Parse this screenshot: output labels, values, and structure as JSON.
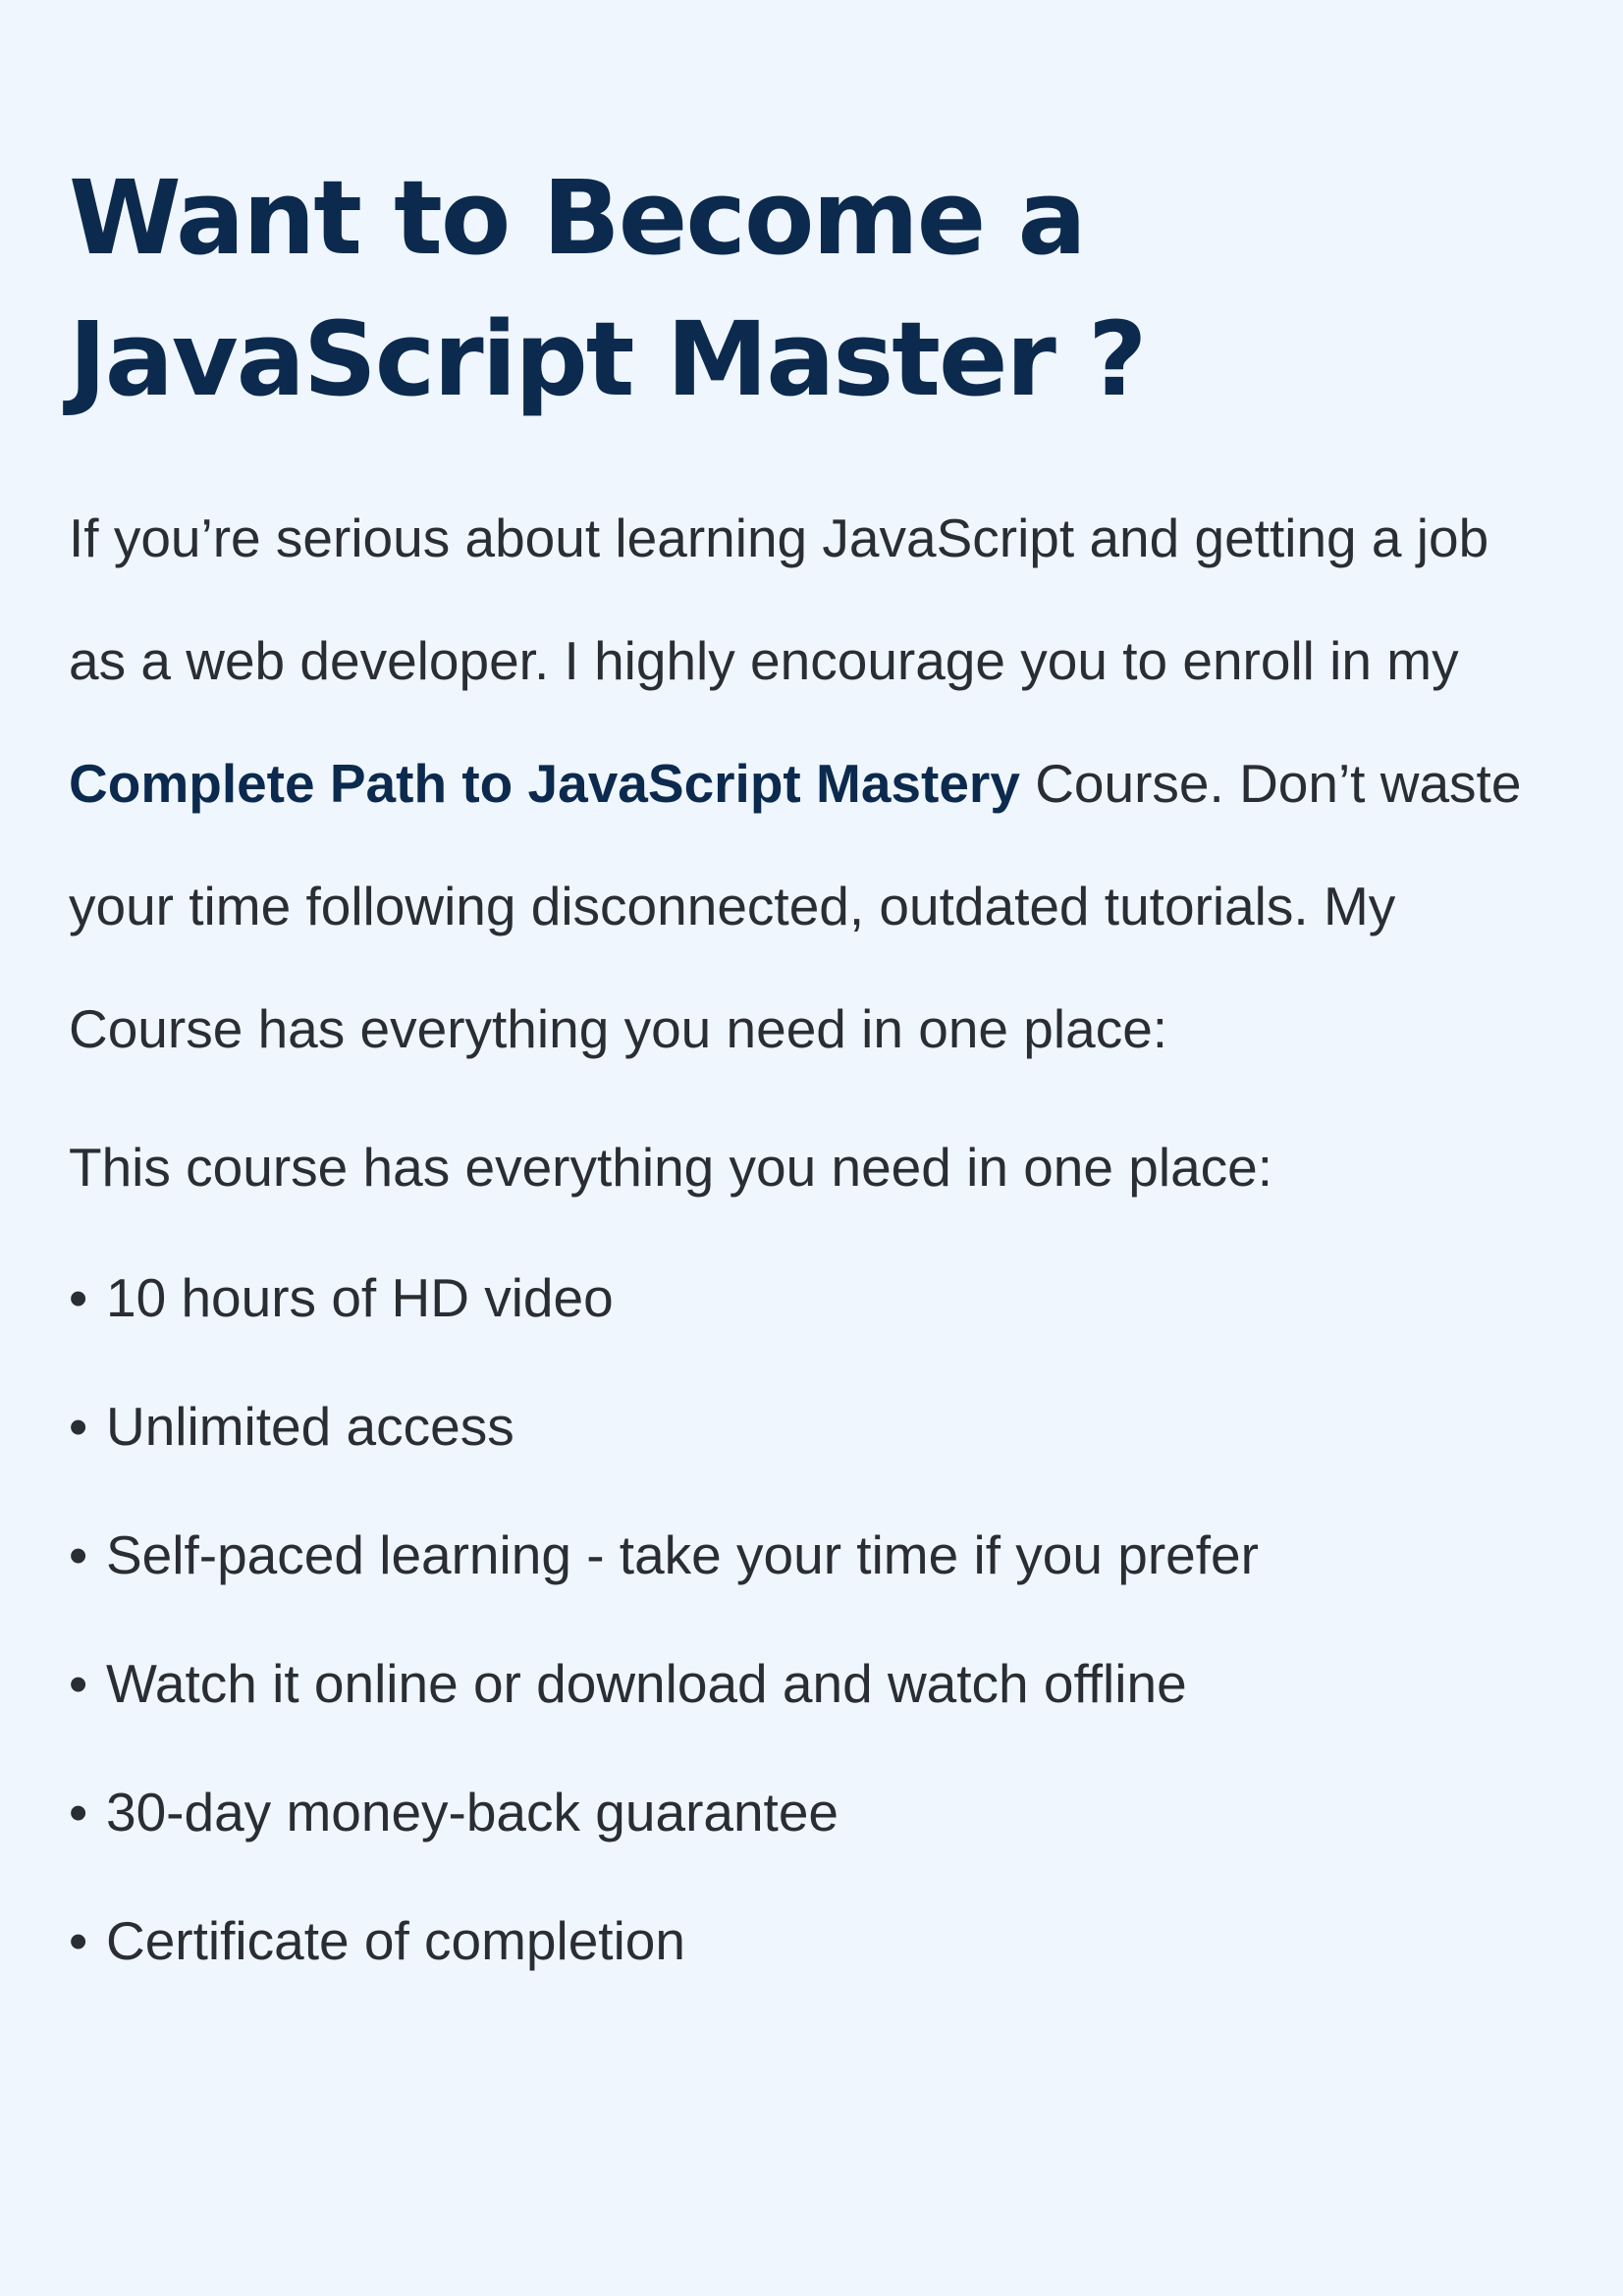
{
  "heading": {
    "line1": "Want to Become a",
    "line2": "JavaScript Master ?"
  },
  "intro": {
    "text_before_link": "If you’re serious about learning JavaScript and getting a job as a web developer. I highly encourage you to enroll in my ",
    "link_text": "Complete Path to JavaScript Mastery",
    "text_after_link": " Course. Don’t waste your time following disconnected, outdated tutorials. My Course has everything you need in one place:"
  },
  "lead": "This course has everything you need in one place:",
  "bullet_glyph": "•",
  "features": [
    "10 hours of HD video",
    "Unlimited access",
    "Self-paced learning - take your time if you prefer",
    "Watch it online or download and watch offline",
    "30-day money-back guarantee",
    "Certificate of completion"
  ],
  "colors": {
    "background": "#eff6fe",
    "heading": "#0c2a4e",
    "link": "#0c2a4e",
    "body_text": "#2a2d33"
  }
}
